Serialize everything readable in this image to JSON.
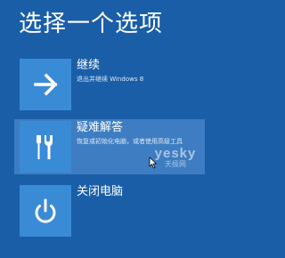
{
  "header": {
    "title": "选择一个选项"
  },
  "options": [
    {
      "title": "继续",
      "description": "退出并继续 Windows 8",
      "icon": "arrow-right-icon"
    },
    {
      "title": "疑难解答",
      "description": "恢复或初始化电脑，或者使用高级工具",
      "icon": "tools-icon"
    },
    {
      "title": "关闭电脑",
      "description": "",
      "icon": "power-icon"
    }
  ],
  "watermark": {
    "main": "yesky",
    "sub": "天极网"
  },
  "colors": {
    "background": "#1a5ea8",
    "tile": "#3a8bd6",
    "selected_row": "#3e7dc2"
  }
}
